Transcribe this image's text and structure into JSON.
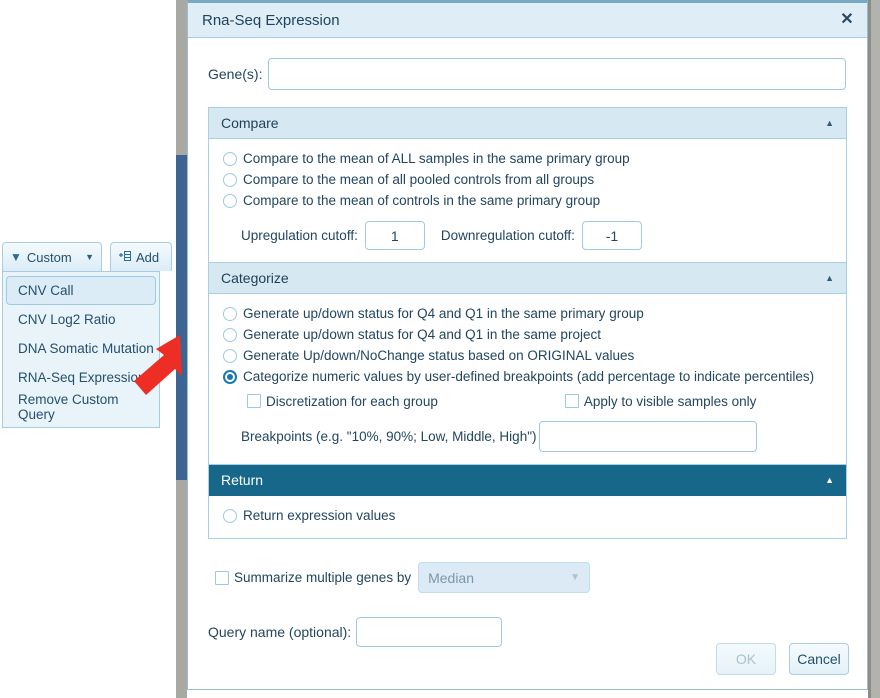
{
  "sidebar": {
    "toolbar": {
      "custom_label": "Custom",
      "custom_icon": "filter-icon",
      "custom_caret": "▼",
      "add_label": "Add",
      "add_icon": "add-column-icon"
    },
    "menu_items": [
      {
        "label": "CNV Call",
        "selected": true
      },
      {
        "label": "CNV Log2 Ratio",
        "selected": false
      },
      {
        "label": "DNA Somatic Mutation",
        "selected": false
      },
      {
        "label": "RNA-Seq Expression",
        "selected": false
      },
      {
        "label": "Remove Custom Query",
        "selected": false
      }
    ]
  },
  "annotation": {
    "arrow_color": "#ee2d24",
    "points_to": "RNA-Seq Expression"
  },
  "dialog": {
    "title": "Rna-Seq Expression",
    "close_icon": "close-icon",
    "gene": {
      "label": "Gene(s):",
      "value": "",
      "placeholder": ""
    },
    "sections": {
      "compare": {
        "header": "Compare",
        "collapse_caret": "▲",
        "options": [
          {
            "label": "Compare to the mean of ALL samples in the same primary group",
            "checked": false
          },
          {
            "label": "Compare to the mean of all pooled controls from all groups",
            "checked": false
          },
          {
            "label": "Compare to the mean of controls in the same primary group",
            "checked": false
          }
        ],
        "upregulation_label": "Upregulation cutoff:",
        "upregulation_value": "1",
        "downregulation_label": "Downregulation cutoff:",
        "downregulation_value": "-1"
      },
      "categorize": {
        "header": "Categorize",
        "collapse_caret": "▲",
        "options": [
          {
            "label": "Generate up/down status for Q4 and Q1 in the same primary group",
            "checked": false
          },
          {
            "label": "Generate up/down status for Q4 and Q1 in the same project",
            "checked": false
          },
          {
            "label": "Generate Up/down/NoChange status based on ORIGINAL values",
            "checked": false
          },
          {
            "label": "Categorize numeric values by user-defined breakpoints (add percentage to indicate percentiles)",
            "checked": true
          }
        ],
        "discretization_label": "Discretization for each group",
        "discretization_checked": false,
        "visible_samples_label": "Apply to visible samples only",
        "visible_samples_checked": false,
        "breakpoints_label": "Breakpoints (e.g. \"10%, 90%; Low, Middle, High\")",
        "breakpoints_value": ""
      },
      "return": {
        "header": "Return",
        "collapse_caret": "▲",
        "options": [
          {
            "label": "Return expression values",
            "checked": false
          }
        ]
      }
    },
    "summarize": {
      "label": "Summarize multiple genes by",
      "checked": false,
      "select_value": "Median",
      "caret_icon": "chevron-down-icon"
    },
    "query_name": {
      "label": "Query name (optional):",
      "value": ""
    },
    "footer": {
      "ok_label": "OK",
      "ok_disabled": true,
      "cancel_label": "Cancel"
    }
  },
  "colors": {
    "panel_header": "#d6e9f3",
    "panel_header_dark": "#17678b",
    "titlebar": "#deedf6",
    "accent_blue": "#1878b4",
    "scrollbar_thumb": "#3d6593",
    "annotation_red": "#ee2d24"
  }
}
